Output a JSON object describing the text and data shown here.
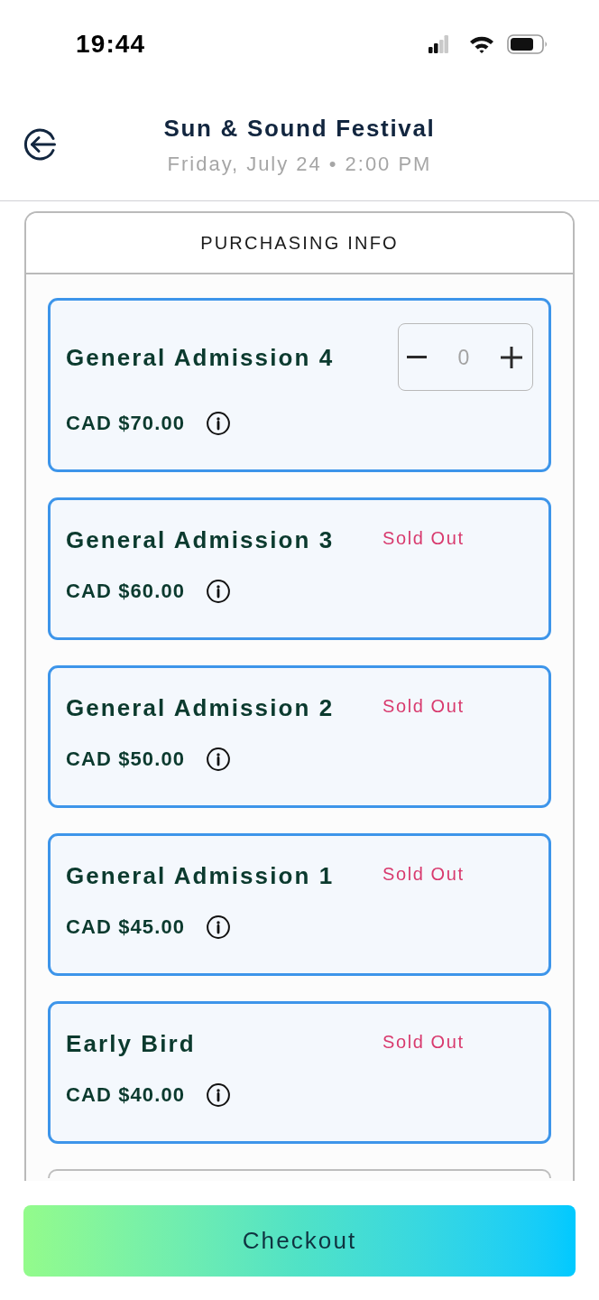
{
  "status_bar": {
    "time": "19:44"
  },
  "header": {
    "title": "Sun & Sound Festival",
    "subtitle": "Friday, July 24 • 2:00 PM"
  },
  "panel": {
    "title": "PURCHASING INFO"
  },
  "tickets": [
    {
      "kind": "stepper",
      "name": "General Admission 4",
      "price": "CAD $70.00",
      "quantity": "0"
    },
    {
      "kind": "sold_out",
      "name": "General Admission 3",
      "price": "CAD $60.00",
      "status": "Sold Out"
    },
    {
      "kind": "sold_out",
      "name": "General Admission 2",
      "price": "CAD $50.00",
      "status": "Sold Out"
    },
    {
      "kind": "sold_out",
      "name": "General Admission 1",
      "price": "CAD $45.00",
      "status": "Sold Out"
    },
    {
      "kind": "sold_out",
      "name": "Early Bird",
      "price": "CAD $40.00",
      "status": "Sold Out"
    }
  ],
  "checkout_button": {
    "label": "Checkout"
  }
}
